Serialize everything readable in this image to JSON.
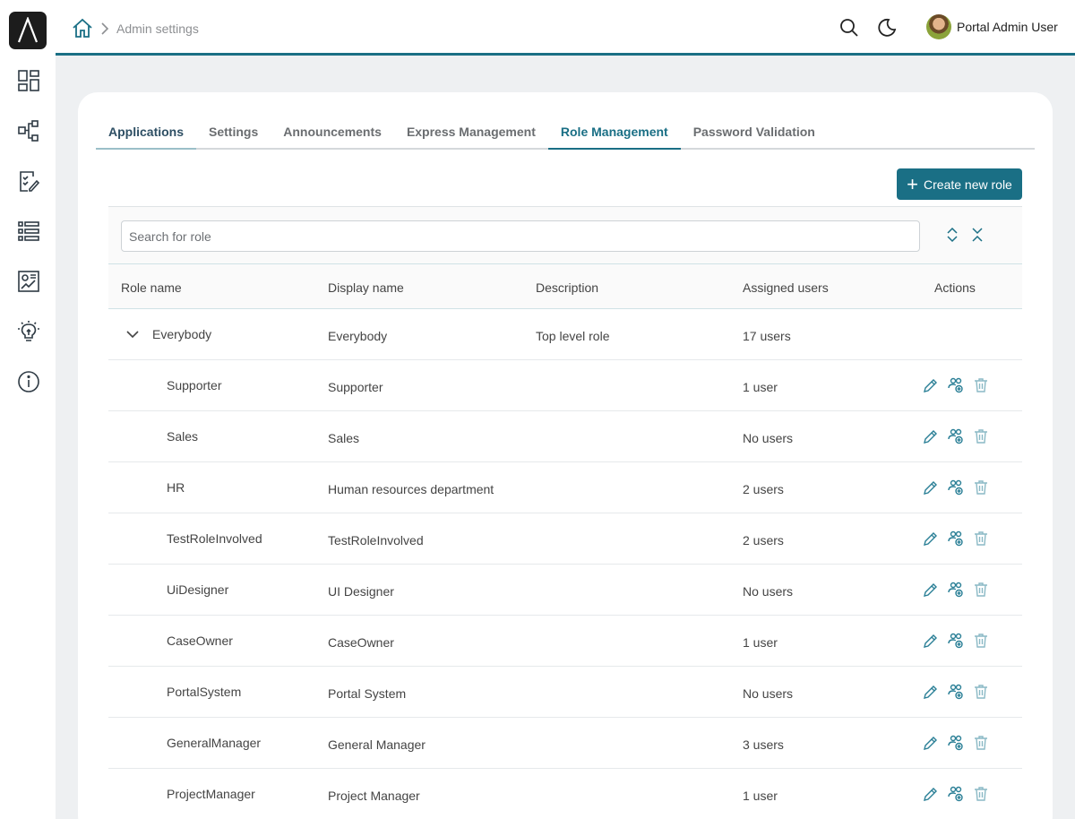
{
  "nav": {
    "logo_text": "/\\",
    "items": [
      {
        "icon": "dashboard-icon"
      },
      {
        "icon": "process-icon"
      },
      {
        "icon": "tasks-icon"
      },
      {
        "icon": "list-icon"
      },
      {
        "icon": "statistics-icon"
      },
      {
        "icon": "lightbulb-icon"
      },
      {
        "icon": "info-icon"
      }
    ]
  },
  "header": {
    "breadcrumb": "Admin settings",
    "user_name": "Portal Admin User"
  },
  "tabs": [
    {
      "label": "Applications"
    },
    {
      "label": "Settings"
    },
    {
      "label": "Announcements"
    },
    {
      "label": "Express Management"
    },
    {
      "label": "Role Management"
    },
    {
      "label": "Password Validation"
    }
  ],
  "active_tab": "Role Management",
  "toolbar": {
    "create_label": "Create new role"
  },
  "search": {
    "placeholder": "Search for role"
  },
  "table": {
    "headers": {
      "role_name": "Role name",
      "display_name": "Display name",
      "description": "Description",
      "assigned_users": "Assigned users",
      "actions": "Actions"
    },
    "rows": [
      {
        "role": "Everybody",
        "display": "Everybody",
        "description": "Top level role",
        "users": "17 users",
        "level": 0,
        "expanded": true
      },
      {
        "role": "Supporter",
        "display": "Supporter",
        "description": "",
        "users": "1 user",
        "level": 1
      },
      {
        "role": "Sales",
        "display": "Sales",
        "description": "",
        "users": "No users",
        "level": 1
      },
      {
        "role": "HR",
        "display": "Human resources department",
        "description": "",
        "users": "2 users",
        "level": 1
      },
      {
        "role": "TestRoleInvolved",
        "display": "TestRoleInvolved",
        "description": "",
        "users": "2 users",
        "level": 1
      },
      {
        "role": "UiDesigner",
        "display": "UI Designer",
        "description": "",
        "users": "No users",
        "level": 1
      },
      {
        "role": "CaseOwner",
        "display": "CaseOwner",
        "description": "",
        "users": "1 user",
        "level": 1
      },
      {
        "role": "PortalSystem",
        "display": "Portal System",
        "description": "",
        "users": "No users",
        "level": 1
      },
      {
        "role": "GeneralManager",
        "display": "General Manager",
        "description": "",
        "users": "3 users",
        "level": 1
      },
      {
        "role": "ProjectManager",
        "display": "Project Manager",
        "description": "",
        "users": "1 user",
        "level": 1
      }
    ]
  },
  "colors": {
    "accent": "#1a6f85",
    "icon": "#2a7f96"
  }
}
